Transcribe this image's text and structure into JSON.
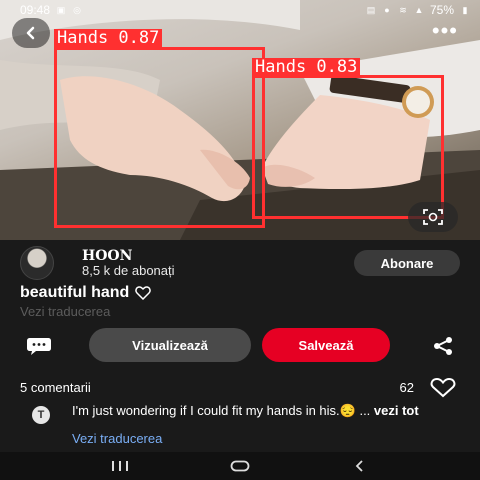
{
  "status_bar": {
    "time": "09:48",
    "battery": "75%",
    "left_icons": [
      "image-icon",
      "whatsapp-icon"
    ],
    "right_icons": [
      "vpn-icon",
      "location-icon",
      "wifi-icon",
      "signal-icon",
      "battery-icon"
    ]
  },
  "detections": [
    {
      "label": "Hands 0.87"
    },
    {
      "label": "Hands 0.83"
    }
  ],
  "profile": {
    "name": "HOON",
    "subscribers": "8,5 k de abonați",
    "follow_label": "Abonare"
  },
  "pin": {
    "title": "beautiful hand",
    "translate_label": "Vezi traducerea"
  },
  "actions": {
    "view_label": "Vizualizează",
    "save_label": "Salvează"
  },
  "comments": {
    "count_label": "5 comentarii",
    "likes": "62",
    "items": [
      {
        "avatar_letter": "T",
        "text": "I'm just wondering if I could fit my hands in his.😔 ...",
        "see_more": "vezi tot",
        "translate_label": "Vezi traducerea"
      }
    ]
  },
  "colors": {
    "accent_red": "#e60023",
    "detection_red": "#ff3030",
    "link_blue": "#7aaef5",
    "background": "#1a1a1a"
  }
}
